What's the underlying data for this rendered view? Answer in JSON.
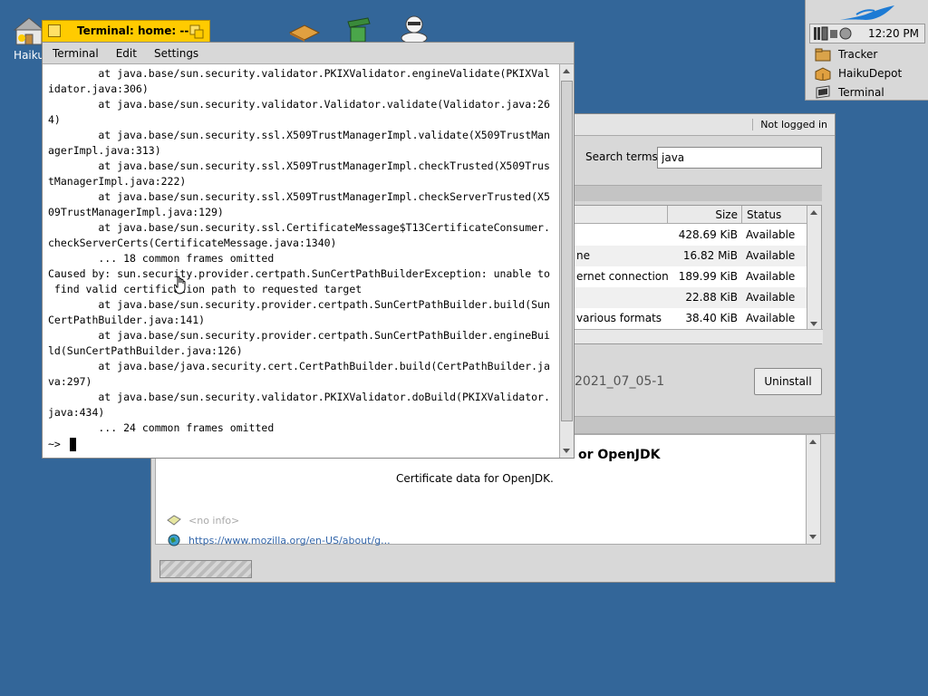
{
  "desktop": {
    "home_icon_label": "Haiku",
    "icons": [
      "package-icon",
      "trash-icon",
      "people-icon"
    ]
  },
  "deskbar": {
    "clock": "12:20 PM",
    "items": [
      {
        "label": "Tracker",
        "icon": "tracker-icon"
      },
      {
        "label": "HaikuDepot",
        "icon": "haikudepot-icon"
      },
      {
        "label": "Terminal",
        "icon": "terminal-icon"
      }
    ]
  },
  "terminal": {
    "title": "Terminal: home: --",
    "menu": [
      "Terminal",
      "Edit",
      "Settings"
    ],
    "lines": [
      "        at java.base/sun.security.validator.PKIXValidator.engineValidate(PKIXVal",
      "idator.java:306)",
      "        at java.base/sun.security.validator.Validator.validate(Validator.java:26",
      "4)",
      "        at java.base/sun.security.ssl.X509TrustManagerImpl.validate(X509TrustMan",
      "agerImpl.java:313)",
      "        at java.base/sun.security.ssl.X509TrustManagerImpl.checkTrusted(X509Trus",
      "tManagerImpl.java:222)",
      "        at java.base/sun.security.ssl.X509TrustManagerImpl.checkServerTrusted(X5",
      "09TrustManagerImpl.java:129)",
      "        at java.base/sun.security.ssl.CertificateMessage$T13CertificateConsumer.",
      "checkServerCerts(CertificateMessage.java:1340)",
      "        ... 18 common frames omitted",
      "Caused by: sun.security.provider.certpath.SunCertPathBuilderException: unable to",
      " find valid certification path to requested target",
      "        at java.base/sun.security.provider.certpath.SunCertPathBuilder.build(Sun",
      "CertPathBuilder.java:141)",
      "        at java.base/sun.security.provider.certpath.SunCertPathBuilder.engineBui",
      "ld(SunCertPathBuilder.java:126)",
      "        at java.base/java.security.cert.CertPathBuilder.build(CertPathBuilder.ja",
      "va:297)",
      "        at java.base/sun.security.validator.PKIXValidator.doBuild(PKIXValidator.",
      "java:434)",
      "        ... 24 common frames omitted"
    ],
    "prompt": "~>"
  },
  "haikudepot": {
    "login_status": "Not logged in",
    "search_label": "Search terms:",
    "search_value": "java",
    "columns": {
      "size": "Size",
      "status": "Status"
    },
    "rows": [
      {
        "name": "",
        "size": "428.69 KiB",
        "status": "Available"
      },
      {
        "name": "ne",
        "size": "16.82 MiB",
        "status": "Available"
      },
      {
        "name": "ernet connection",
        "size": "189.99 KiB",
        "status": "Available"
      },
      {
        "name": "",
        "size": "22.88 KiB",
        "status": "Available"
      },
      {
        "name": "various formats",
        "size": "38.40 KiB",
        "status": "Available"
      }
    ],
    "version": "2021_07_05-1",
    "uninstall_label": "Uninstall",
    "package_title": "or OpenJDK",
    "description": "Certificate data for OpenJDK.",
    "no_info": "<no info>",
    "homepage": "https://www.mozilla.org/en-US/about/g..."
  }
}
